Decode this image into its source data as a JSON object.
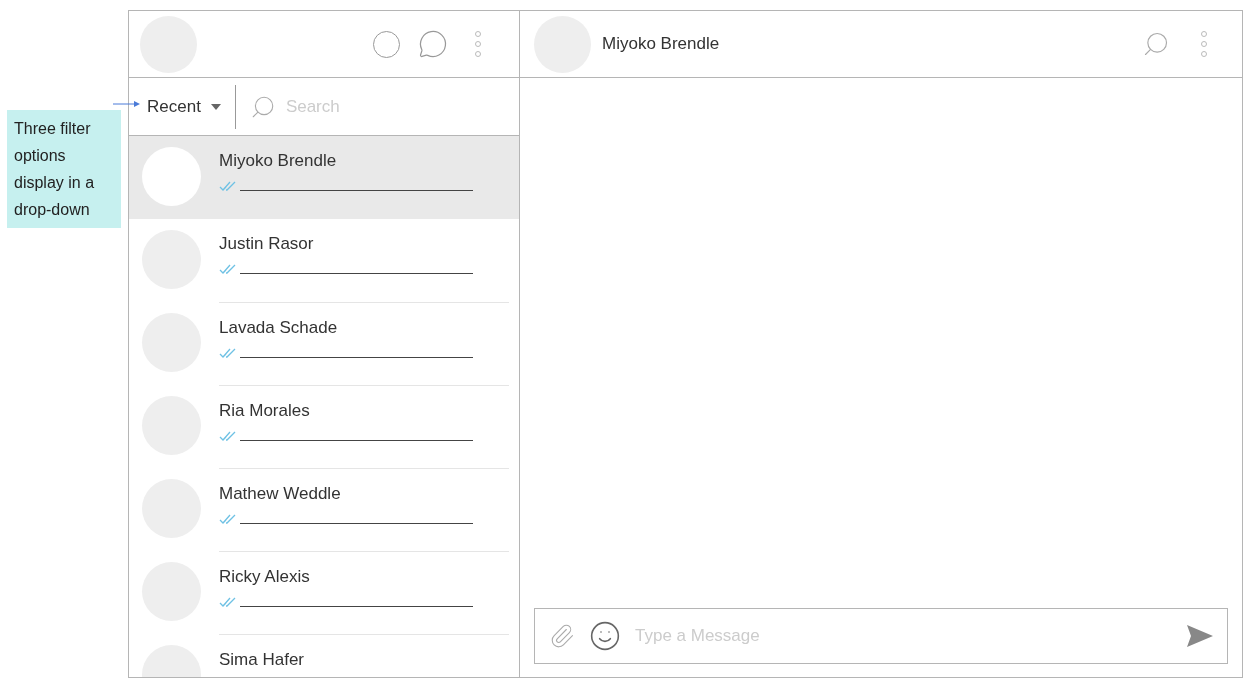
{
  "callout": {
    "text": "Three filter options display in a drop-down"
  },
  "filter": {
    "label": "Recent"
  },
  "search": {
    "placeholder": "Search"
  },
  "contacts": [
    {
      "name": "Miyoko Brendle",
      "selected": true
    },
    {
      "name": "Justin Rasor",
      "selected": false
    },
    {
      "name": "Lavada Schade",
      "selected": false
    },
    {
      "name": "Ria Morales",
      "selected": false
    },
    {
      "name": "Mathew Weddle",
      "selected": false
    },
    {
      "name": "Ricky Alexis",
      "selected": false
    },
    {
      "name": "Sima Hafer",
      "selected": false
    }
  ],
  "chat_header": {
    "name": "Miyoko Brendle"
  },
  "composer": {
    "placeholder": "Type a Message"
  }
}
